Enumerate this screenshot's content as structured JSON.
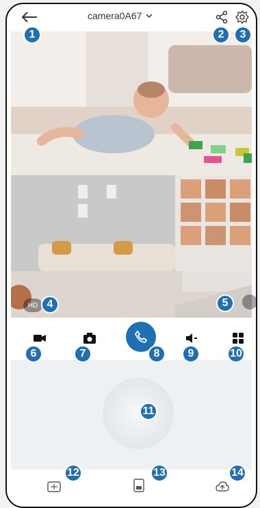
{
  "header": {
    "title": "camera0A67"
  },
  "overlay": {
    "hd_label": "HD"
  },
  "callouts": [
    "1",
    "2",
    "3",
    "4",
    "5",
    "6",
    "7",
    "8",
    "9",
    "10",
    "11",
    "12",
    "13",
    "14"
  ],
  "icons": {
    "back": "back-arrow-icon",
    "title_dropdown": "chevron-down-icon",
    "share": "share-icon",
    "settings": "gear-icon",
    "fullscreen": "fullscreen-icon",
    "record": "video-record-icon",
    "snapshot": "camera-snapshot-icon",
    "talk": "phone-call-icon",
    "volume": "speaker-icon",
    "more": "grid-menu-icon",
    "ptz": "ptz-joystick",
    "playback": "playback-icon",
    "gallery": "album-icon",
    "cloud": "cloud-upload-icon"
  },
  "colors": {
    "accent": "#1f6fb7"
  }
}
